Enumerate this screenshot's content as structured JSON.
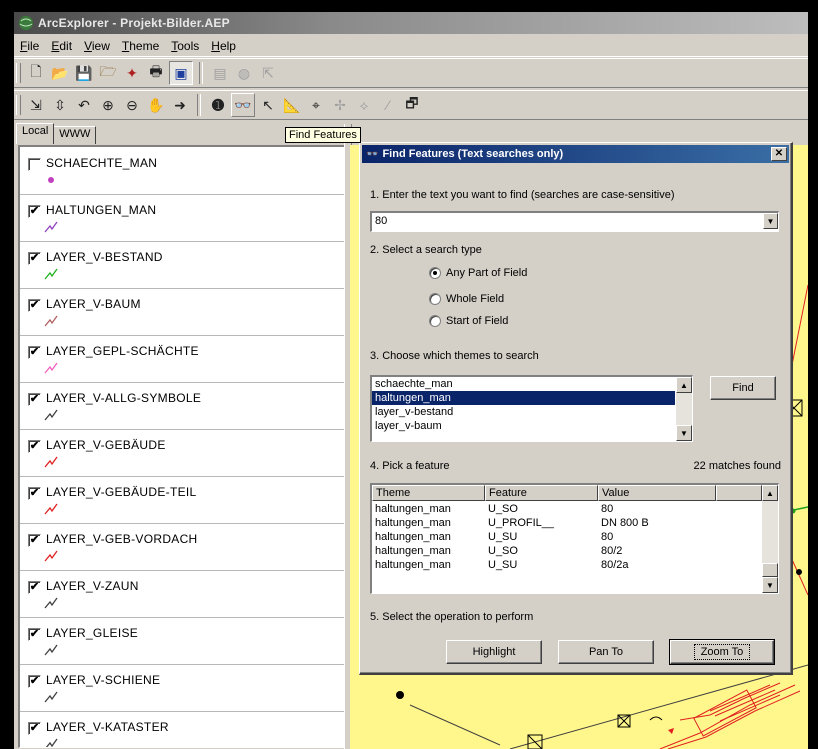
{
  "window": {
    "title": "ArcExplorer - Projekt-Bilder.AEP"
  },
  "menu": [
    "File",
    "Edit",
    "View",
    "Theme",
    "Tools",
    "Help"
  ],
  "toolbar1": [
    "new-document-icon",
    "open-folder-icon",
    "save-icon",
    "add-theme-icon",
    "import-icon",
    "print-icon",
    "layout-icon",
    "copy-icon",
    "query-icon",
    "export-icon"
  ],
  "toolbar2": [
    "pan-to-point-icon",
    "zoom-previous-icon",
    "undo-icon",
    "zoom-in-icon",
    "zoom-out-icon",
    "pan-hand-icon",
    "full-extent-icon",
    "identify-icon",
    "find-features-icon",
    "select-icon",
    "measure-icon",
    "buffer-icon",
    "locate-icon",
    "spatial-query-icon",
    "clear-icon",
    "properties-icon"
  ],
  "tooltip": "Find Features",
  "tabs": {
    "local": "Local",
    "www": "WWW"
  },
  "layers": [
    {
      "name": "SCHAECHTE_MAN",
      "checked": false,
      "color": "#c040c0",
      "symbol": "dot"
    },
    {
      "name": "HALTUNGEN_MAN",
      "checked": true,
      "color": "#9040c0",
      "symbol": "line"
    },
    {
      "name": "LAYER_V-BESTAND",
      "checked": true,
      "color": "#20b020",
      "symbol": "line"
    },
    {
      "name": "LAYER_V-BAUM",
      "checked": true,
      "color": "#b06060",
      "symbol": "line"
    },
    {
      "name": "LAYER_GEPL-SCHÄCHTE",
      "checked": true,
      "color": "#f060c0",
      "symbol": "line"
    },
    {
      "name": "LAYER_V-ALLG-SYMBOLE",
      "checked": true,
      "color": "#404040",
      "symbol": "line"
    },
    {
      "name": "LAYER_V-GEBÄUDE",
      "checked": true,
      "color": "#e02020",
      "symbol": "line"
    },
    {
      "name": "LAYER_V-GEBÄUDE-TEIL",
      "checked": true,
      "color": "#e02020",
      "symbol": "line"
    },
    {
      "name": "LAYER_V-GEB-VORDACH",
      "checked": true,
      "color": "#e02020",
      "symbol": "line"
    },
    {
      "name": "LAYER_V-ZAUN",
      "checked": true,
      "color": "#404040",
      "symbol": "line"
    },
    {
      "name": "LAYER_GLEISE",
      "checked": true,
      "color": "#404040",
      "symbol": "line"
    },
    {
      "name": "LAYER_V-SCHIENE",
      "checked": true,
      "color": "#404040",
      "symbol": "line"
    },
    {
      "name": "LAYER_V-KATASTER",
      "checked": true,
      "color": "#404040",
      "symbol": "line"
    }
  ],
  "dialog": {
    "title": "Find Features (Text searches only)",
    "step1": "1. Enter the text you want to find (searches are case-sensitive)",
    "search_value": "80",
    "step2": "2. Select a search type",
    "search_types": [
      {
        "label": "Any Part of Field",
        "selected": true
      },
      {
        "label": "Whole Field",
        "selected": false
      },
      {
        "label": "Start of Field",
        "selected": false
      }
    ],
    "step3": "3. Choose which themes to search",
    "themes": [
      {
        "label": "schaechte_man",
        "selected": false
      },
      {
        "label": "haltungen_man",
        "selected": true
      },
      {
        "label": "layer_v-bestand",
        "selected": false
      },
      {
        "label": "layer_v-baum",
        "selected": false
      }
    ],
    "find_button": "Find",
    "step4": "4. Pick a feature",
    "match_count": "22 matches found",
    "columns": [
      "Theme",
      "Feature",
      "Value"
    ],
    "rows": [
      [
        "haltungen_man",
        "U_SO",
        "80"
      ],
      [
        "haltungen_man",
        "U_PROFIL__",
        "DN 800 B"
      ],
      [
        "haltungen_man",
        "U_SU",
        "80"
      ],
      [
        "haltungen_man",
        "U_SO",
        "80/2"
      ],
      [
        "haltungen_man",
        "U_SU",
        "80/2a"
      ]
    ],
    "step5": "5. Select the operation to perform",
    "buttons": {
      "highlight": "Highlight",
      "pan": "Pan To",
      "zoom": "Zoom To"
    }
  },
  "colors": {
    "map_background": "#fff78c",
    "dialog_title": "#0a246a",
    "selection": "#0a246a"
  }
}
